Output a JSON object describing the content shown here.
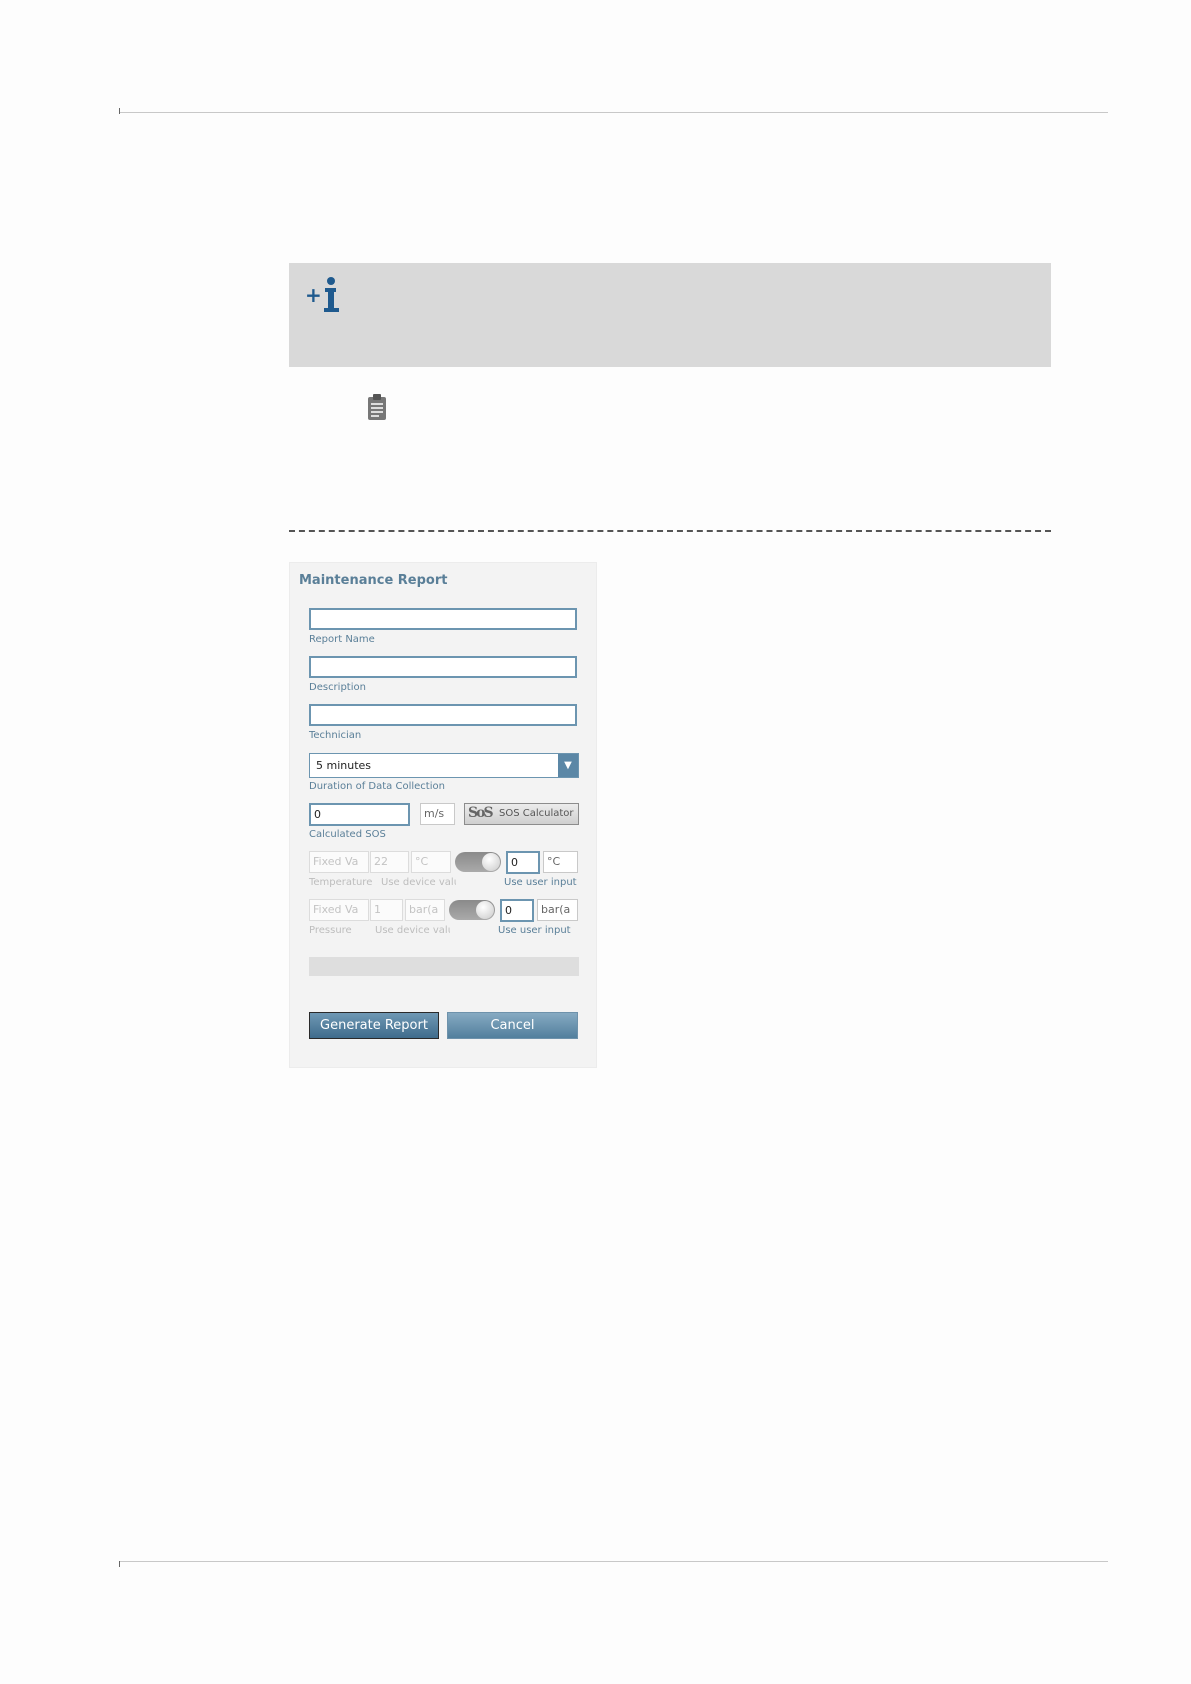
{
  "dialog": {
    "title": "Maintenance Report",
    "report_name_label": "Report Name",
    "report_name_value": "",
    "description_label": "Description",
    "description_value": "",
    "technician_label": "Technician",
    "technician_value": "",
    "duration": {
      "selected": "5 minutes",
      "label": "Duration of Data Collection"
    },
    "sos": {
      "value": "0",
      "unit": "m/s",
      "calculator_label": "SOS Calculator",
      "calculator_glyph": "SoS",
      "label": "Calculated SOS"
    },
    "temperature": {
      "fixed_value": "Fixed Va",
      "device_value": "22",
      "device_unit": "°C",
      "user_value": "0",
      "user_unit": "°C",
      "label": "Temperature",
      "device_label": "Use device valu",
      "user_label": "Use user input"
    },
    "pressure": {
      "fixed_value": "Fixed Va",
      "device_value": "1",
      "device_unit": "bar(a",
      "user_value": "0",
      "user_unit": "bar(a",
      "label": "Pressure",
      "device_label": "Use device valu",
      "user_label": "Use user input"
    },
    "progress": 0,
    "generate_label": "Generate Report",
    "cancel_label": "Cancel"
  },
  "icons": {
    "info": "info-plus-icon",
    "report": "clipboard-icon",
    "dropdown": "chevron-down-icon"
  },
  "colors": {
    "accent": "#5a7f98",
    "field_border": "#6c95b0",
    "button_primary": "#4a7696",
    "info_box": "#d9d9d9"
  }
}
